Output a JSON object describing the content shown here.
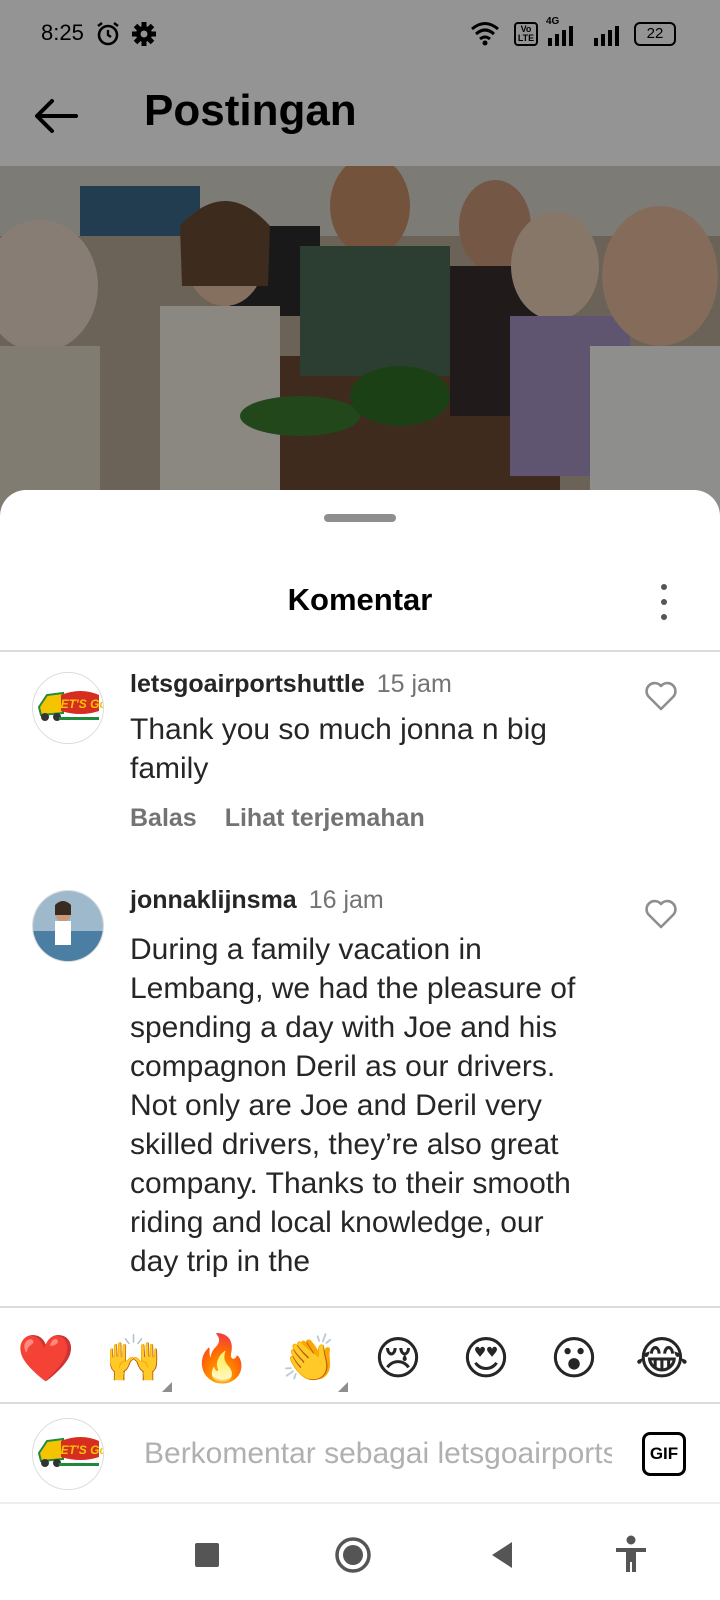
{
  "status_bar": {
    "time": "8:25",
    "network_type": "4G",
    "volte": "Vo LTE",
    "battery": "22",
    "icons": [
      "alarm-icon",
      "gear-icon",
      "wifi-icon",
      "volte-icon",
      "signal-icon",
      "battery-icon"
    ]
  },
  "header": {
    "title": "Postingan"
  },
  "sheet": {
    "title": "Komentar"
  },
  "comments": [
    {
      "username": "letsgoairportshuttle",
      "time": "15 jam",
      "text": "Thank you so much jonna n big family",
      "reply": "Balas",
      "translate": "Lihat terjemahan"
    },
    {
      "username": "jonnaklijnsma",
      "time": "16 jam",
      "text": "During a family vacation in Lembang, we had the pleasure of spending a day with Joe and his compagnon Deril as our drivers. Not only are Joe and Deril very skilled drivers, they’re also great company. Thanks to their smooth riding and local knowledge, our day trip in the"
    }
  ],
  "emoji_bar": [
    {
      "glyph": "❤️",
      "icon": "red-heart-icon"
    },
    {
      "glyph": "🙌",
      "icon": "raising-hands-icon"
    },
    {
      "glyph": "🔥",
      "icon": "fire-icon"
    },
    {
      "glyph": "👏",
      "icon": "clapping-hands-icon"
    },
    {
      "glyph": "😢",
      "icon": "crying-face-icon"
    },
    {
      "glyph": "😍",
      "icon": "heart-eyes-icon"
    },
    {
      "glyph": "😮",
      "icon": "surprised-face-icon"
    },
    {
      "glyph": "😂",
      "icon": "tears-of-joy-icon"
    }
  ],
  "composer": {
    "placeholder": "Berkomentar sebagai letsgoairportshuttle...",
    "gif_label": "GIF"
  },
  "logo": {
    "text": "LET'S Go"
  },
  "colors": {
    "logo_red": "#d62d20",
    "logo_yellow": "#f5c400",
    "logo_green": "#1f8a3b"
  }
}
